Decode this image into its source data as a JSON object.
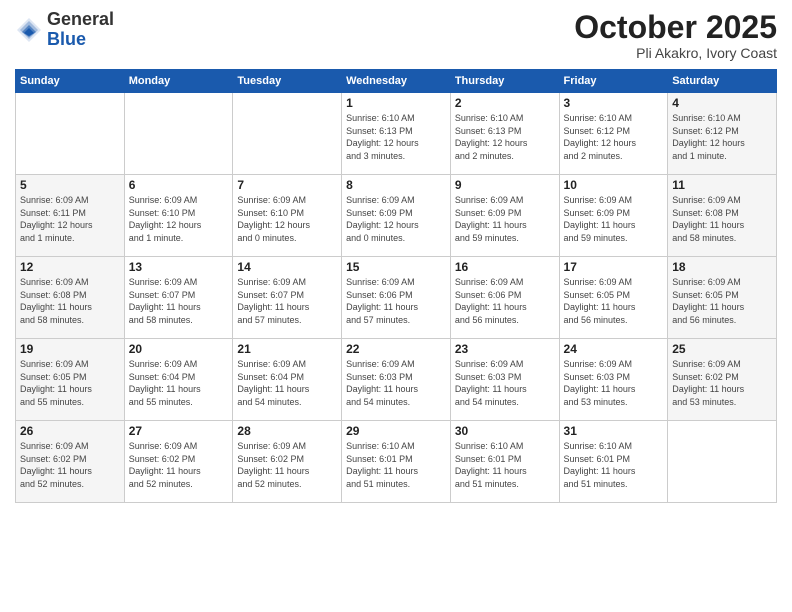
{
  "logo": {
    "general": "General",
    "blue": "Blue"
  },
  "header": {
    "month": "October 2025",
    "location": "Pli Akakro, Ivory Coast"
  },
  "weekdays": [
    "Sunday",
    "Monday",
    "Tuesday",
    "Wednesday",
    "Thursday",
    "Friday",
    "Saturday"
  ],
  "weeks": [
    [
      {
        "day": "",
        "info": ""
      },
      {
        "day": "",
        "info": ""
      },
      {
        "day": "",
        "info": ""
      },
      {
        "day": "1",
        "info": "Sunrise: 6:10 AM\nSunset: 6:13 PM\nDaylight: 12 hours\nand 3 minutes."
      },
      {
        "day": "2",
        "info": "Sunrise: 6:10 AM\nSunset: 6:13 PM\nDaylight: 12 hours\nand 2 minutes."
      },
      {
        "day": "3",
        "info": "Sunrise: 6:10 AM\nSunset: 6:12 PM\nDaylight: 12 hours\nand 2 minutes."
      },
      {
        "day": "4",
        "info": "Sunrise: 6:10 AM\nSunset: 6:12 PM\nDaylight: 12 hours\nand 1 minute."
      }
    ],
    [
      {
        "day": "5",
        "info": "Sunrise: 6:09 AM\nSunset: 6:11 PM\nDaylight: 12 hours\nand 1 minute."
      },
      {
        "day": "6",
        "info": "Sunrise: 6:09 AM\nSunset: 6:10 PM\nDaylight: 12 hours\nand 1 minute."
      },
      {
        "day": "7",
        "info": "Sunrise: 6:09 AM\nSunset: 6:10 PM\nDaylight: 12 hours\nand 0 minutes."
      },
      {
        "day": "8",
        "info": "Sunrise: 6:09 AM\nSunset: 6:09 PM\nDaylight: 12 hours\nand 0 minutes."
      },
      {
        "day": "9",
        "info": "Sunrise: 6:09 AM\nSunset: 6:09 PM\nDaylight: 11 hours\nand 59 minutes."
      },
      {
        "day": "10",
        "info": "Sunrise: 6:09 AM\nSunset: 6:09 PM\nDaylight: 11 hours\nand 59 minutes."
      },
      {
        "day": "11",
        "info": "Sunrise: 6:09 AM\nSunset: 6:08 PM\nDaylight: 11 hours\nand 58 minutes."
      }
    ],
    [
      {
        "day": "12",
        "info": "Sunrise: 6:09 AM\nSunset: 6:08 PM\nDaylight: 11 hours\nand 58 minutes."
      },
      {
        "day": "13",
        "info": "Sunrise: 6:09 AM\nSunset: 6:07 PM\nDaylight: 11 hours\nand 58 minutes."
      },
      {
        "day": "14",
        "info": "Sunrise: 6:09 AM\nSunset: 6:07 PM\nDaylight: 11 hours\nand 57 minutes."
      },
      {
        "day": "15",
        "info": "Sunrise: 6:09 AM\nSunset: 6:06 PM\nDaylight: 11 hours\nand 57 minutes."
      },
      {
        "day": "16",
        "info": "Sunrise: 6:09 AM\nSunset: 6:06 PM\nDaylight: 11 hours\nand 56 minutes."
      },
      {
        "day": "17",
        "info": "Sunrise: 6:09 AM\nSunset: 6:05 PM\nDaylight: 11 hours\nand 56 minutes."
      },
      {
        "day": "18",
        "info": "Sunrise: 6:09 AM\nSunset: 6:05 PM\nDaylight: 11 hours\nand 56 minutes."
      }
    ],
    [
      {
        "day": "19",
        "info": "Sunrise: 6:09 AM\nSunset: 6:05 PM\nDaylight: 11 hours\nand 55 minutes."
      },
      {
        "day": "20",
        "info": "Sunrise: 6:09 AM\nSunset: 6:04 PM\nDaylight: 11 hours\nand 55 minutes."
      },
      {
        "day": "21",
        "info": "Sunrise: 6:09 AM\nSunset: 6:04 PM\nDaylight: 11 hours\nand 54 minutes."
      },
      {
        "day": "22",
        "info": "Sunrise: 6:09 AM\nSunset: 6:03 PM\nDaylight: 11 hours\nand 54 minutes."
      },
      {
        "day": "23",
        "info": "Sunrise: 6:09 AM\nSunset: 6:03 PM\nDaylight: 11 hours\nand 54 minutes."
      },
      {
        "day": "24",
        "info": "Sunrise: 6:09 AM\nSunset: 6:03 PM\nDaylight: 11 hours\nand 53 minutes."
      },
      {
        "day": "25",
        "info": "Sunrise: 6:09 AM\nSunset: 6:02 PM\nDaylight: 11 hours\nand 53 minutes."
      }
    ],
    [
      {
        "day": "26",
        "info": "Sunrise: 6:09 AM\nSunset: 6:02 PM\nDaylight: 11 hours\nand 52 minutes."
      },
      {
        "day": "27",
        "info": "Sunrise: 6:09 AM\nSunset: 6:02 PM\nDaylight: 11 hours\nand 52 minutes."
      },
      {
        "day": "28",
        "info": "Sunrise: 6:09 AM\nSunset: 6:02 PM\nDaylight: 11 hours\nand 52 minutes."
      },
      {
        "day": "29",
        "info": "Sunrise: 6:10 AM\nSunset: 6:01 PM\nDaylight: 11 hours\nand 51 minutes."
      },
      {
        "day": "30",
        "info": "Sunrise: 6:10 AM\nSunset: 6:01 PM\nDaylight: 11 hours\nand 51 minutes."
      },
      {
        "day": "31",
        "info": "Sunrise: 6:10 AM\nSunset: 6:01 PM\nDaylight: 11 hours\nand 51 minutes."
      },
      {
        "day": "",
        "info": ""
      }
    ]
  ]
}
